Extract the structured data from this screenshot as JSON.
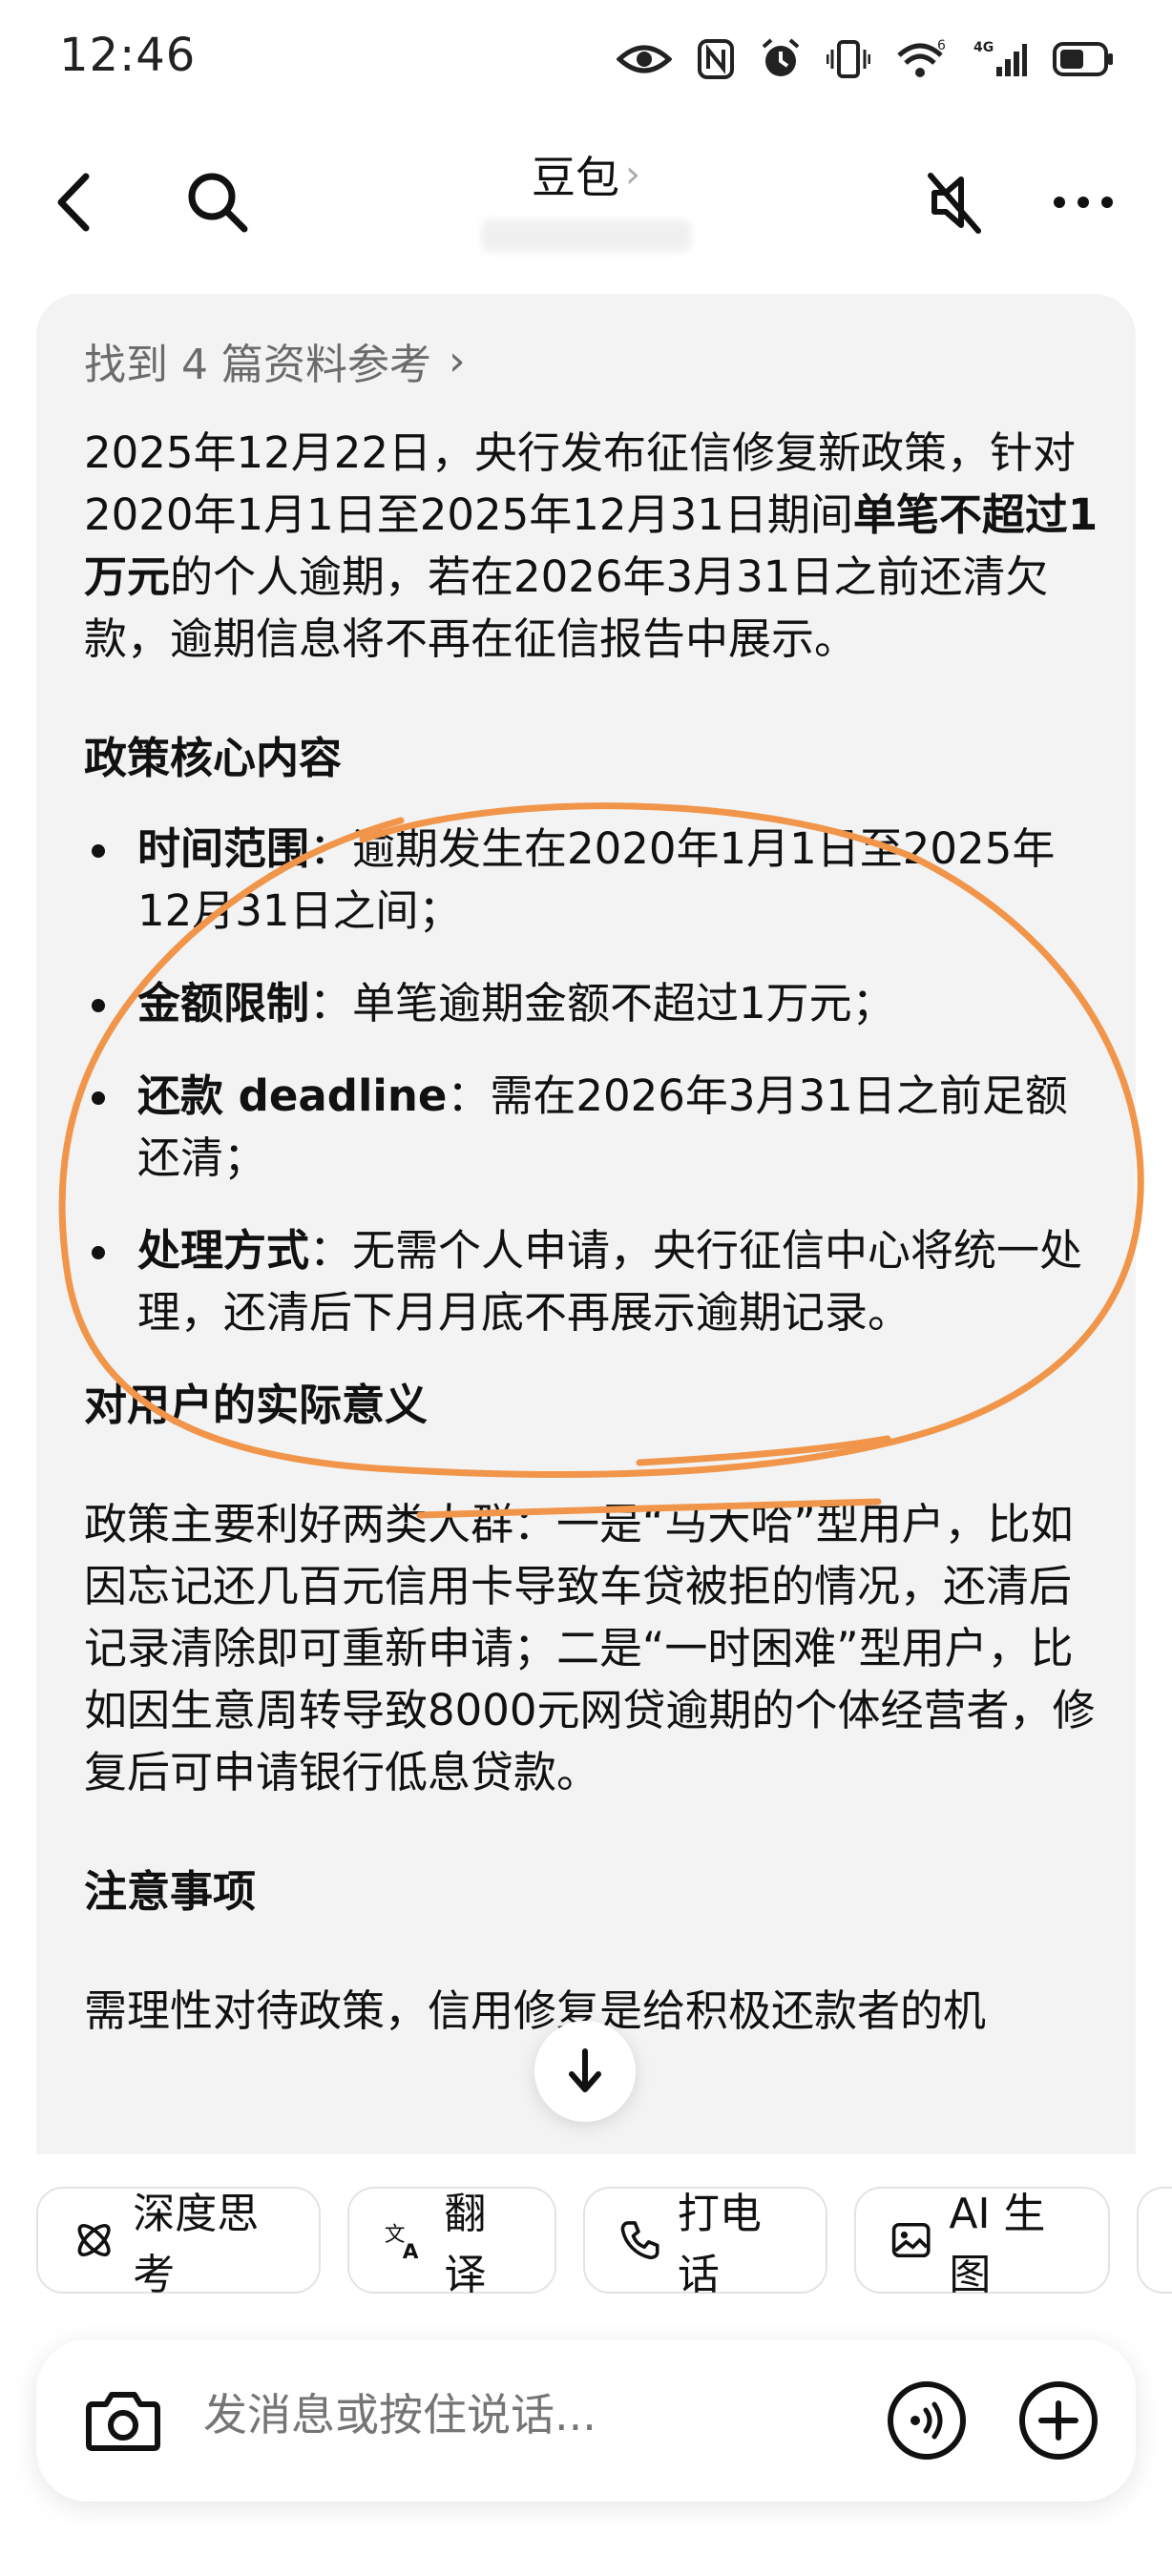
{
  "status_bar": {
    "time": "12:46",
    "icons": [
      "eye-icon",
      "nfc-icon",
      "alarm-icon",
      "vibrate-icon",
      "wifi-6-icon",
      "signal-4g-icon",
      "battery-icon"
    ],
    "wifi_badge": "6",
    "network_badge": "4G"
  },
  "header": {
    "title": "豆包",
    "title_chevron": "›",
    "icons": [
      "back-arrow-icon",
      "search-icon",
      "mute-icon",
      "more-icon"
    ]
  },
  "message": {
    "references": "找到 4 篇资料参考",
    "references_chevron": "›",
    "intro": {
      "pre": "2025年12月22日，央行发布征信修复新政策，针对2020年1月1日至2025年12月31日期间",
      "bold": "单笔不超过1万元",
      "post": "的个人逾期，若在2026年3月31日之前还清欠款，逾期信息将不再在征信报告中展示。"
    },
    "section1_title": "政策核心内容",
    "bullets": [
      {
        "label": "时间范围",
        "text": "：逾期发生在2020年1月1日至2025年12月31日之间；"
      },
      {
        "label": "金额限制",
        "text": "：单笔逾期金额不超过1万元；"
      },
      {
        "label": "还款 deadline",
        "text": "：需在2026年3月31日之前足额还清；"
      },
      {
        "label": "处理方式",
        "text": "：无需个人申请，央行征信中心将统一处理，还清后下月月底不再展示逾期记录。"
      }
    ],
    "section2_title": "对用户的实际意义",
    "section2_text": "政策主要利好两类人群：一是“马大哈”型用户，比如因忘记还几百元信用卡导致车贷被拒的情况，还清后记录清除即可重新申请；二是“一时困难”型用户，比如因生意周转导致8000元网贷逾期的个体经营者，修复后可申请银行低息贷款。",
    "section3_title": "注意事项",
    "section3_text": "需理性对待政策，信用修复是给积极还款者的机"
  },
  "annotation_color": "#F0954A",
  "chips": [
    {
      "icon": "deep-think-icon",
      "label": "深度思考"
    },
    {
      "icon": "translate-icon",
      "label": "翻译"
    },
    {
      "icon": "phone-icon",
      "label": "打电话"
    },
    {
      "icon": "image-gen-icon",
      "label": "AI 生图"
    }
  ],
  "input": {
    "placeholder": "发消息或按住说话...",
    "icons": [
      "camera-icon",
      "voice-icon",
      "plus-icon"
    ]
  }
}
